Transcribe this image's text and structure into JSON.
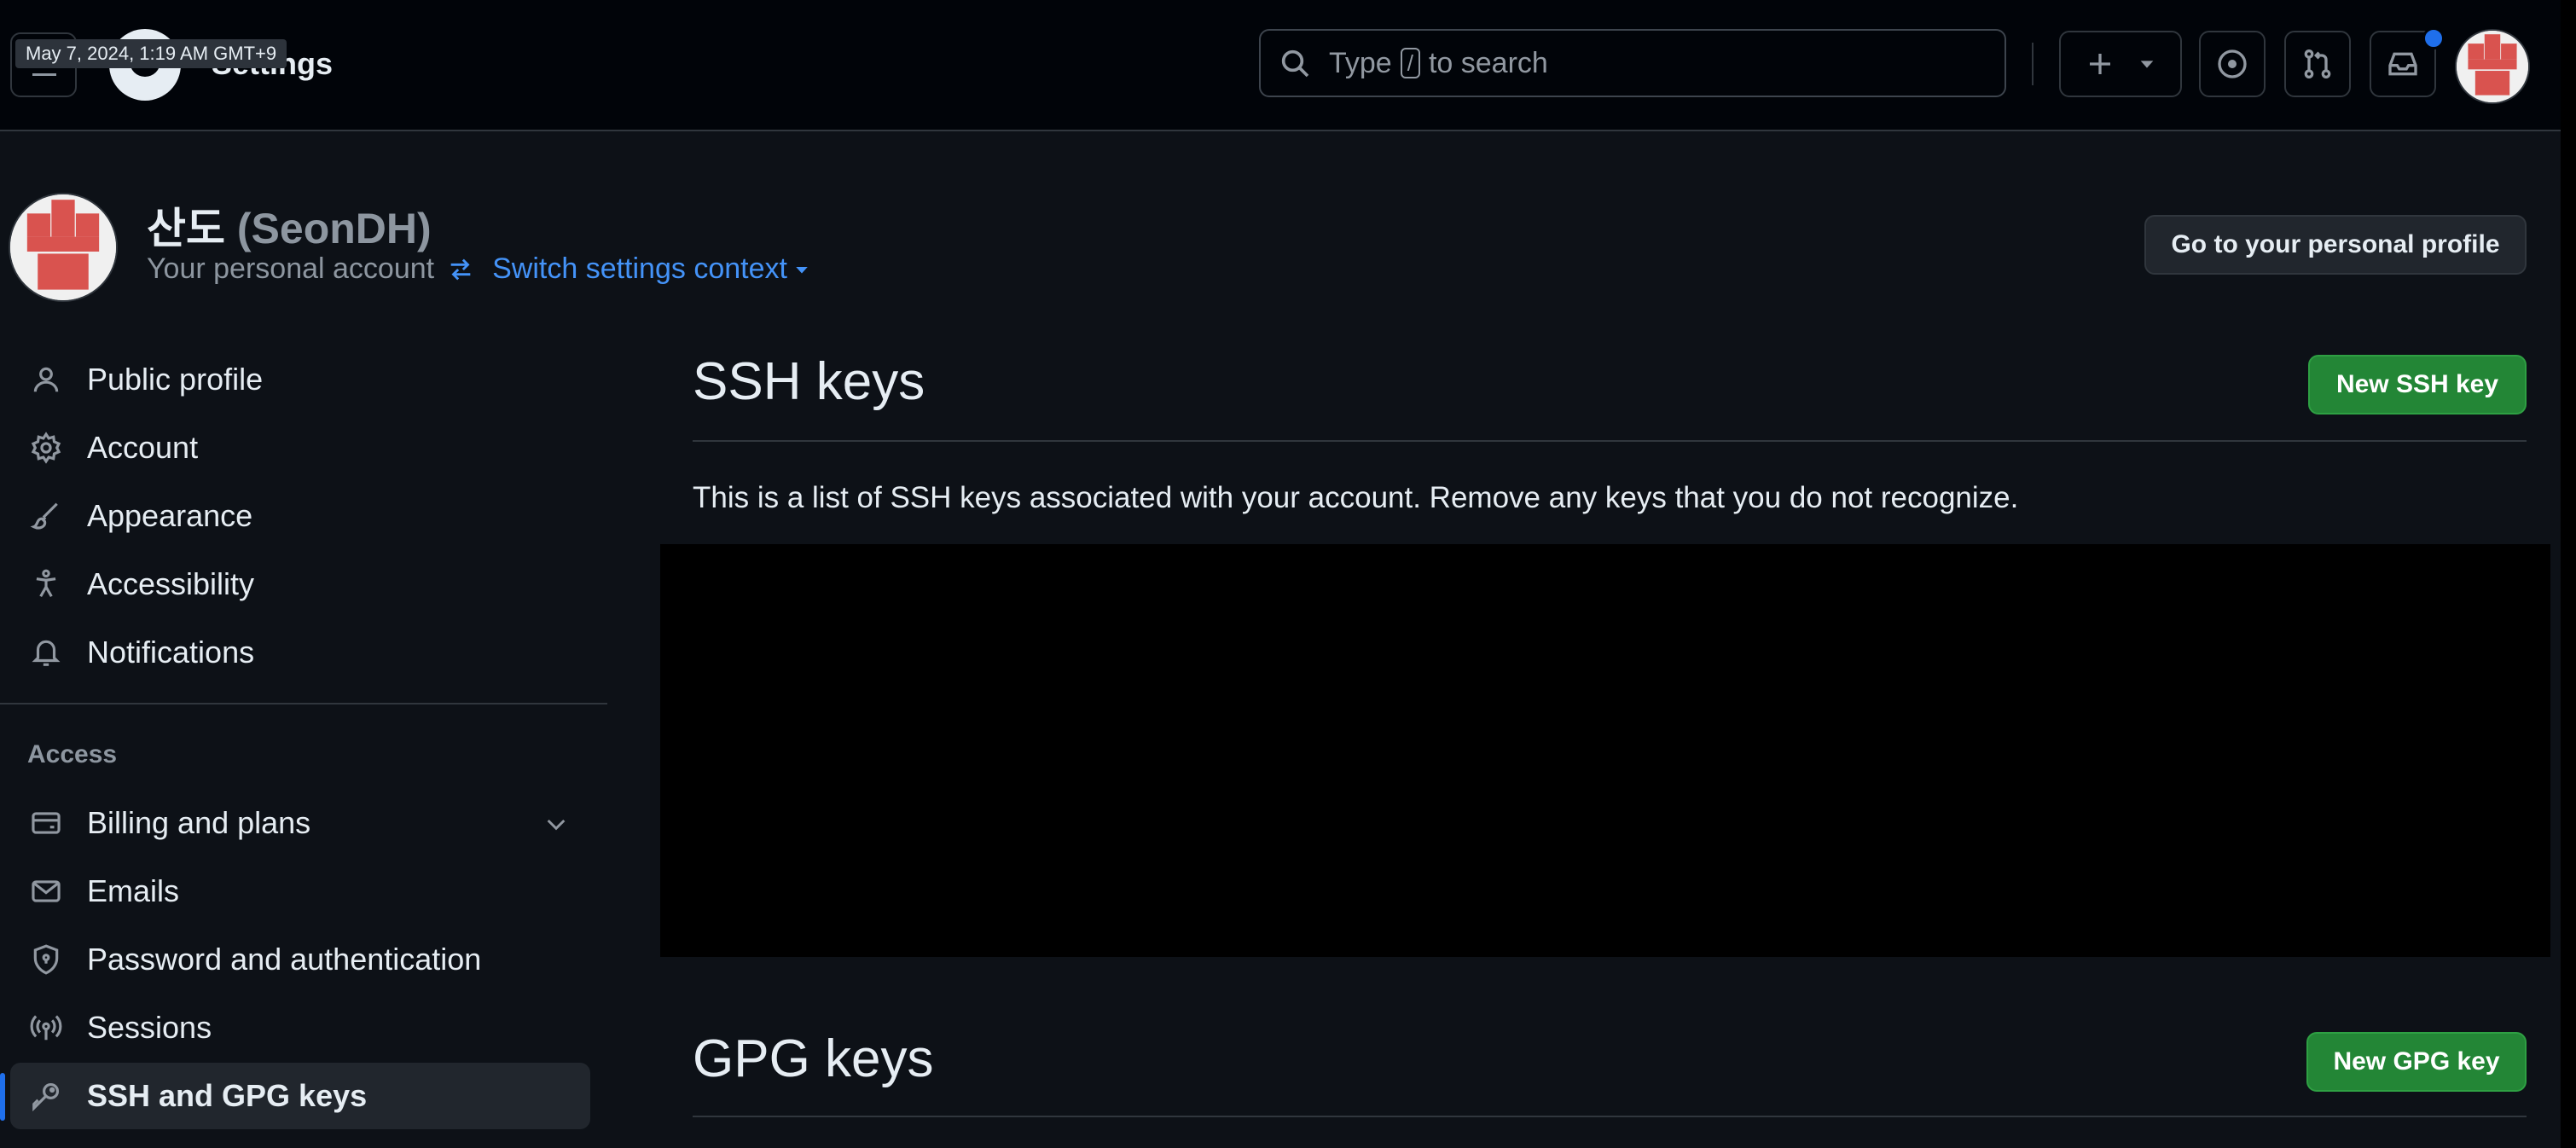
{
  "header": {
    "context_title": "Settings",
    "timestamp": "May 7, 2024, 1:19 AM GMT+9",
    "search": {
      "prefix": "Type",
      "key": "/",
      "suffix": "to search"
    }
  },
  "profile": {
    "name": "산도",
    "login": "(SeonDH)",
    "account_label": "Your personal account",
    "switch_label": "Switch settings context",
    "profile_button": "Go to your personal profile",
    "avatar_colors": {
      "red": "#d9534f",
      "bg": "#f0f0f0"
    }
  },
  "sidebar": {
    "items": [
      {
        "label": "Public profile",
        "icon": "person-icon"
      },
      {
        "label": "Account",
        "icon": "gear-icon"
      },
      {
        "label": "Appearance",
        "icon": "paintbrush-icon"
      },
      {
        "label": "Accessibility",
        "icon": "accessibility-icon"
      },
      {
        "label": "Notifications",
        "icon": "bell-icon"
      }
    ],
    "access_heading": "Access",
    "access_items": [
      {
        "label": "Billing and plans",
        "icon": "credit-card-icon"
      },
      {
        "label": "Emails",
        "icon": "mail-icon"
      },
      {
        "label": "Password and authentication",
        "icon": "shield-lock-icon"
      },
      {
        "label": "Sessions",
        "icon": "broadcast-icon"
      },
      {
        "label": "SSH and GPG keys",
        "icon": "key-icon",
        "active": true
      }
    ]
  },
  "main": {
    "ssh": {
      "title": "SSH keys",
      "button": "New SSH key",
      "description": "This is a list of SSH keys associated with your account. Remove any keys that you do not recognize."
    },
    "gpg": {
      "title": "GPG keys",
      "button": "New GPG key"
    }
  },
  "colors": {
    "bg": "#0d1117",
    "header_bg": "#010409",
    "accent_blue": "#4493f8",
    "green": "#238636",
    "notif_blue": "#1f6feb"
  }
}
